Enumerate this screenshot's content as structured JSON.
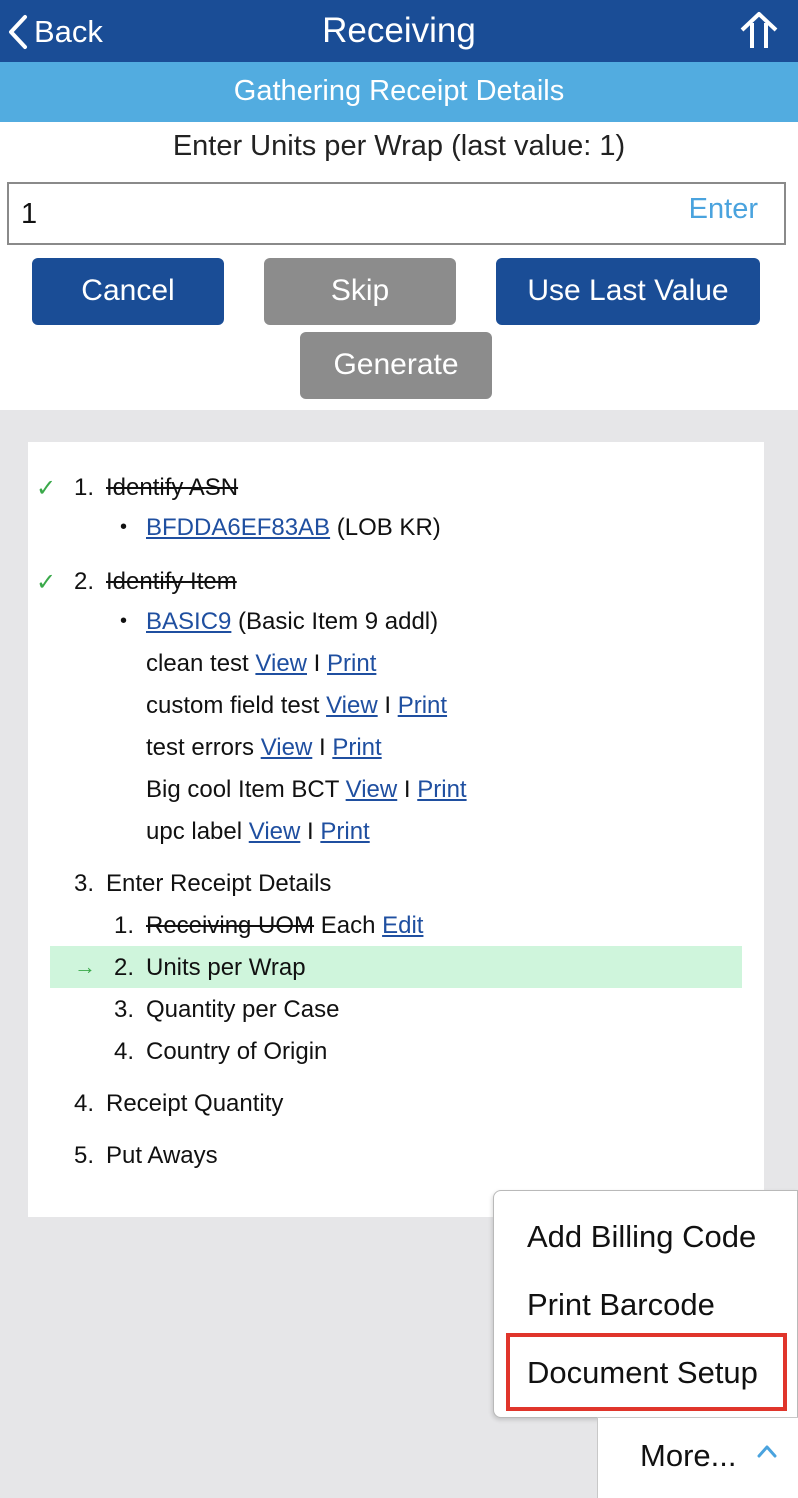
{
  "header": {
    "back_label": "Back",
    "title": "Receiving",
    "home_icon": "home-up-arrow-icon"
  },
  "subheader": {
    "text": "Gathering Receipt Details"
  },
  "prompt": {
    "text": "Enter Units per Wrap (last value: 1)"
  },
  "input": {
    "value": "1",
    "enter_label": "Enter"
  },
  "buttons": {
    "cancel": "Cancel",
    "skip": "Skip",
    "use_last_value": "Use Last Value",
    "generate": "Generate"
  },
  "colors": {
    "header_bg": "#1a4d96",
    "subheader_bg": "#52ace0",
    "active_step_bg": "#cff5dc",
    "check_color": "#3aa94a",
    "highlight_box": "#e0352b"
  },
  "steps": {
    "s1": {
      "check": "✓",
      "num": "1.",
      "label": "Identify ASN",
      "asn_link": "BFDDA6EF83AB",
      "asn_note": "(LOB KR)"
    },
    "s2": {
      "check": "✓",
      "num": "2.",
      "label": "Identify Item",
      "item_link": "BASIC9",
      "item_note": "(Basic Item 9 addl)",
      "labels": [
        {
          "name": "clean test",
          "view": "View",
          "sep": "I",
          "print": "Print"
        },
        {
          "name": "custom field test",
          "view": "View",
          "sep": "I",
          "print": "Print"
        },
        {
          "name": "test errors",
          "view": "View",
          "sep": "I",
          "print": "Print"
        },
        {
          "name": "Big cool Item BCT",
          "view": "View",
          "sep": "I",
          "print": "Print"
        },
        {
          "name": "upc label",
          "view": "View",
          "sep": "I",
          "print": "Print"
        }
      ]
    },
    "s3": {
      "num": "3.",
      "label": "Enter Receipt Details",
      "sub": [
        {
          "num": "1.",
          "label": "Receiving UOM",
          "value": "Each",
          "edit": "Edit"
        },
        {
          "num": "2.",
          "label": "Units per Wrap",
          "arrow": "→"
        },
        {
          "num": "3.",
          "label": "Quantity per Case"
        },
        {
          "num": "4.",
          "label": "Country of Origin"
        }
      ]
    },
    "s4": {
      "num": "4.",
      "label": "Receipt Quantity"
    },
    "s5": {
      "num": "5.",
      "label": "Put Aways"
    }
  },
  "menu": {
    "items": [
      "Add Billing Code",
      "Print Barcode",
      "Document Setup"
    ],
    "more_label": "More...",
    "more_icon": "chevron-up-icon"
  }
}
